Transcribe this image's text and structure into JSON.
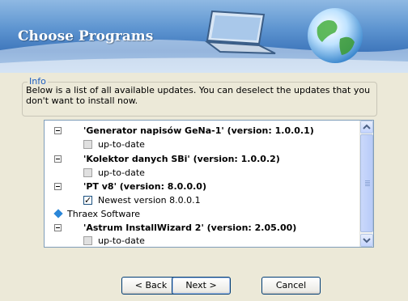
{
  "header": {
    "title": "Choose Programs"
  },
  "info": {
    "legend": "Info",
    "description": "Below is a list of all available updates. You can deselect the updates that you don't want to install now."
  },
  "list": {
    "items": [
      {
        "type": "program",
        "label": "'Generator napisów GeNa-1' (version: 1.0.0.1)"
      },
      {
        "type": "update",
        "label": "up-to-date",
        "checked": false,
        "enabled": false
      },
      {
        "type": "program",
        "label": "'Kolektor danych SBi' (version: 1.0.0.2)"
      },
      {
        "type": "update",
        "label": "up-to-date",
        "checked": false,
        "enabled": false
      },
      {
        "type": "program",
        "label": "'PT v8' (version: 8.0.0.0)"
      },
      {
        "type": "update",
        "label": "Newest version 8.0.0.1",
        "checked": true,
        "enabled": true
      },
      {
        "type": "vendor",
        "label": "Thraex Software"
      },
      {
        "type": "program",
        "label": "'Astrum InstallWizard 2' (version: 2.05.00)"
      },
      {
        "type": "update",
        "label": "up-to-date",
        "checked": false,
        "enabled": false
      }
    ]
  },
  "buttons": {
    "back": "< Back",
    "next": "Next >",
    "cancel": "Cancel"
  },
  "colors": {
    "banner": "#4f86c8",
    "legend": "#1f5fbf",
    "dialog_bg": "#ece9d8"
  },
  "icons": [
    "laptop-icon",
    "globe-icon",
    "collapse-node-icon",
    "vendor-diamond-icon",
    "scroll-up-arrow-icon",
    "scroll-down-arrow-icon"
  ]
}
